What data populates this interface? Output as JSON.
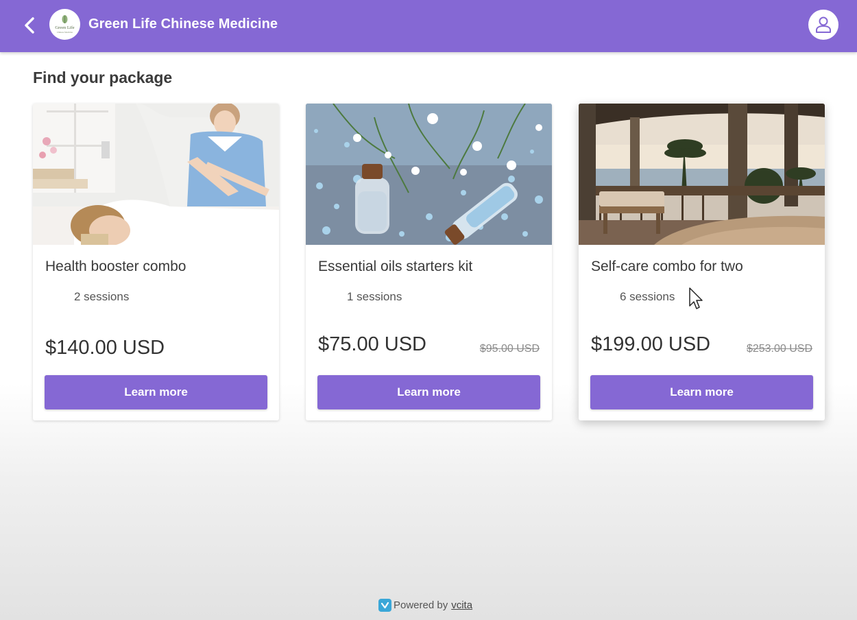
{
  "header": {
    "brand_name": "Green Life Chinese Medicine",
    "logo_text_line1": "Green Life",
    "logo_text_line2": "Chinese Medicine",
    "back_icon": "chevron-left-icon",
    "profile_icon": "user-icon",
    "background_color": "#8568d4"
  },
  "main": {
    "title": "Find your package",
    "packages": [
      {
        "name": "Health booster combo",
        "sessions": "2 sessions",
        "price": "$140.00 USD",
        "original_price": "",
        "button_label": "Learn more"
      },
      {
        "name": "Essential oils starters kit",
        "sessions": "1 sessions",
        "price": "$75.00 USD",
        "original_price": "$95.00 USD",
        "button_label": "Learn more"
      },
      {
        "name": "Self-care combo for two",
        "sessions": "6 sessions",
        "price": "$199.00 USD",
        "original_price": "$253.00 USD",
        "button_label": "Learn more"
      }
    ]
  },
  "footer": {
    "powered_by": "Powered by",
    "brand_link": "vcita"
  },
  "colors": {
    "accent": "#8568d4",
    "vcita_blue": "#3aa7d8"
  }
}
